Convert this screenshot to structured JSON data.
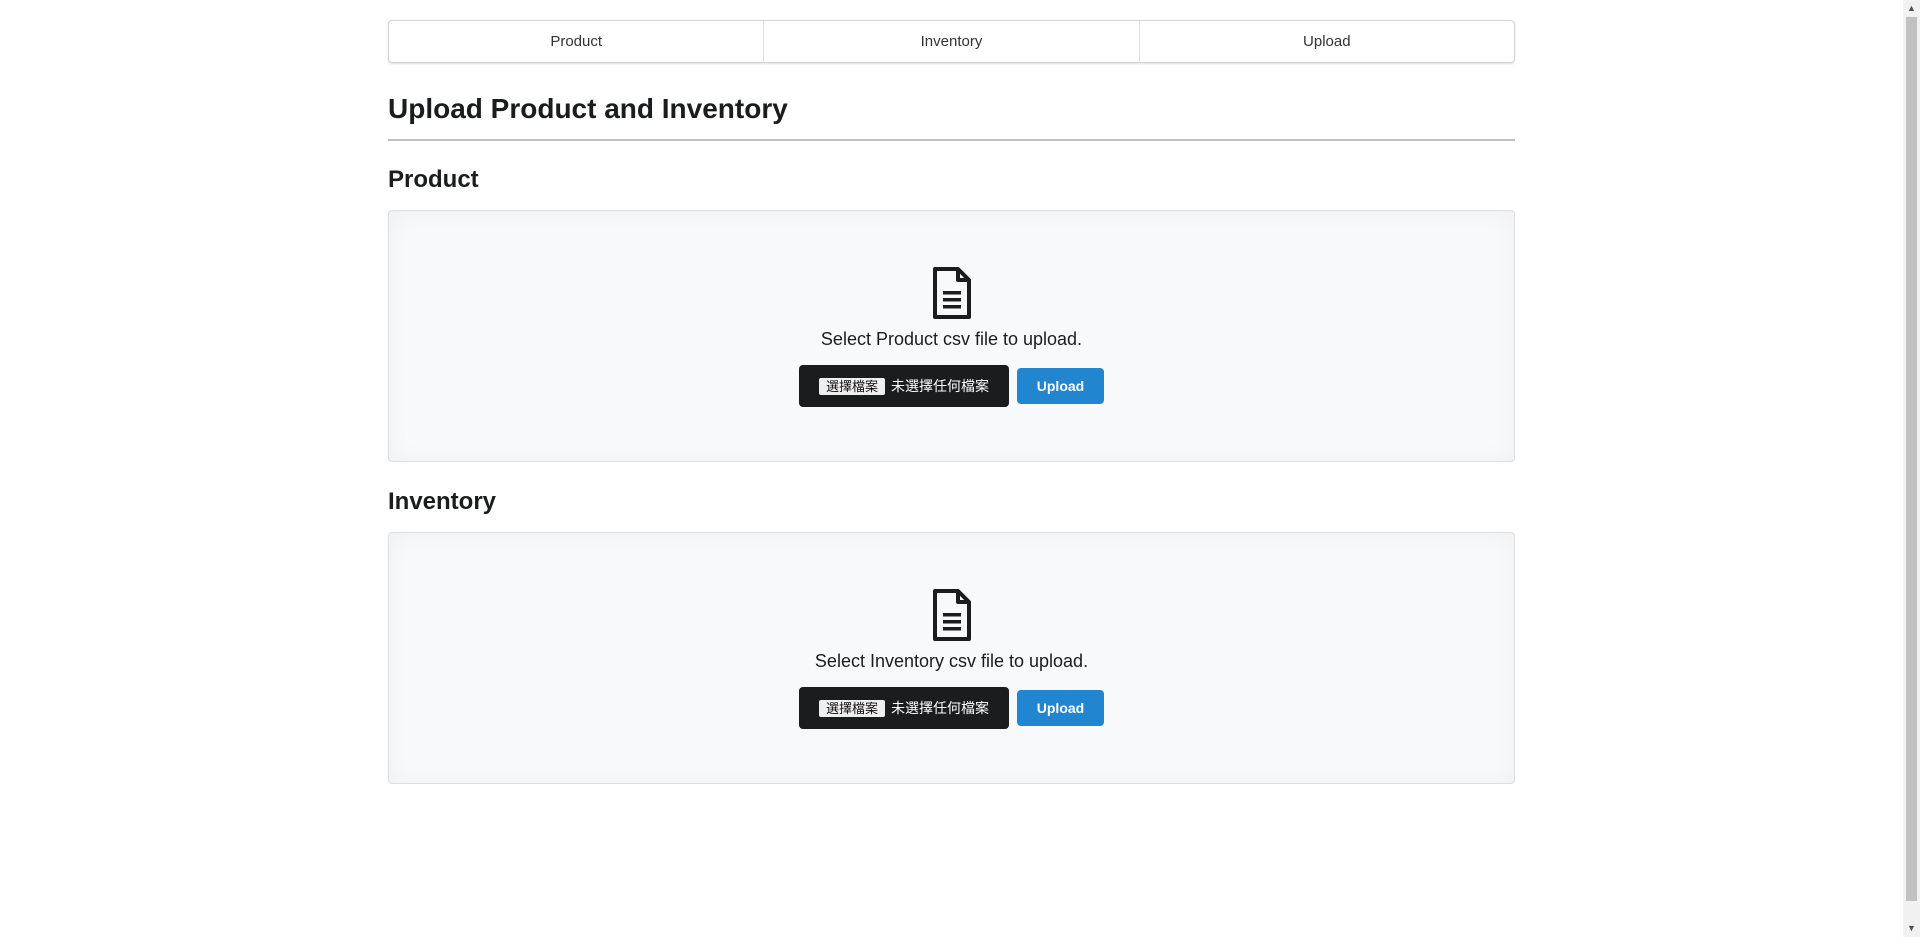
{
  "nav": {
    "tabs": [
      {
        "label": "Product"
      },
      {
        "label": "Inventory"
      },
      {
        "label": "Upload"
      }
    ]
  },
  "page": {
    "title": "Upload Product and Inventory"
  },
  "sections": {
    "product": {
      "title": "Product",
      "prompt": "Select Product csv file to upload.",
      "choose_label": "選擇檔案",
      "file_status": "未選擇任何檔案",
      "upload_label": "Upload"
    },
    "inventory": {
      "title": "Inventory",
      "prompt": "Select Inventory csv file to upload.",
      "choose_label": "選擇檔案",
      "file_status": "未選擇任何檔案",
      "upload_label": "Upload"
    }
  },
  "icons": {
    "file": "file-alternate-outline-icon",
    "scroll_up": "scroll-up-arrow-icon",
    "scroll_down": "scroll-down-arrow-icon"
  },
  "colors": {
    "primary_button": "#2185d0",
    "file_input_bg": "#1b1c1d",
    "panel_bg": "#f8f9fa"
  }
}
